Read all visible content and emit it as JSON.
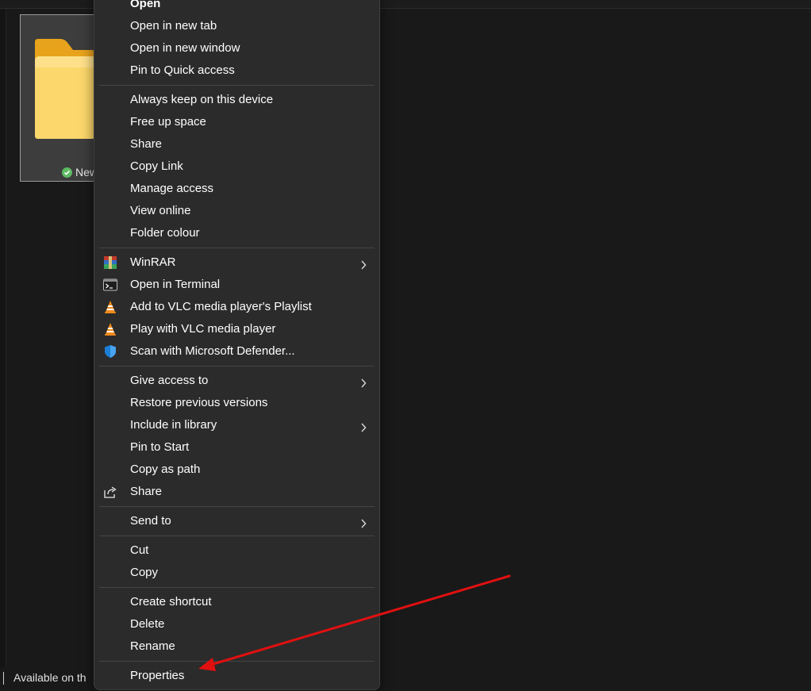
{
  "folder": {
    "name": "New"
  },
  "status_bar": {
    "text": "Available on th"
  },
  "menu": {
    "groups": [
      [
        {
          "label": "Open",
          "bold": true
        },
        {
          "label": "Open in new tab"
        },
        {
          "label": "Open in new window"
        },
        {
          "label": "Pin to Quick access"
        }
      ],
      [
        {
          "label": "Always keep on this device"
        },
        {
          "label": "Free up space"
        },
        {
          "label": "Share"
        },
        {
          "label": "Copy Link"
        },
        {
          "label": "Manage access"
        },
        {
          "label": "View online"
        },
        {
          "label": "Folder colour"
        }
      ],
      [
        {
          "label": "WinRAR",
          "icon": "winrar-icon",
          "submenu": true
        },
        {
          "label": "Open in Terminal",
          "icon": "terminal-icon"
        },
        {
          "label": "Add to VLC media player's Playlist",
          "icon": "vlc-icon"
        },
        {
          "label": "Play with VLC media player",
          "icon": "vlc-icon"
        },
        {
          "label": "Scan with Microsoft Defender...",
          "icon": "defender-shield-icon"
        }
      ],
      [
        {
          "label": "Give access to",
          "submenu": true
        },
        {
          "label": "Restore previous versions"
        },
        {
          "label": "Include in library",
          "submenu": true
        },
        {
          "label": "Pin to Start"
        },
        {
          "label": "Copy as path"
        },
        {
          "label": "Share",
          "icon": "share-icon"
        }
      ],
      [
        {
          "label": "Send to",
          "submenu": true
        }
      ],
      [
        {
          "label": "Cut"
        },
        {
          "label": "Copy"
        }
      ],
      [
        {
          "label": "Create shortcut"
        },
        {
          "label": "Delete"
        },
        {
          "label": "Rename"
        }
      ],
      [
        {
          "label": "Properties"
        }
      ]
    ]
  },
  "annotation": {
    "arrow_color": "#e01010",
    "points_to": "Properties"
  },
  "colors": {
    "menu_bg": "#2b2b2b",
    "folder_yellow": "#f7c948",
    "sync_green": "#5dbb63"
  }
}
